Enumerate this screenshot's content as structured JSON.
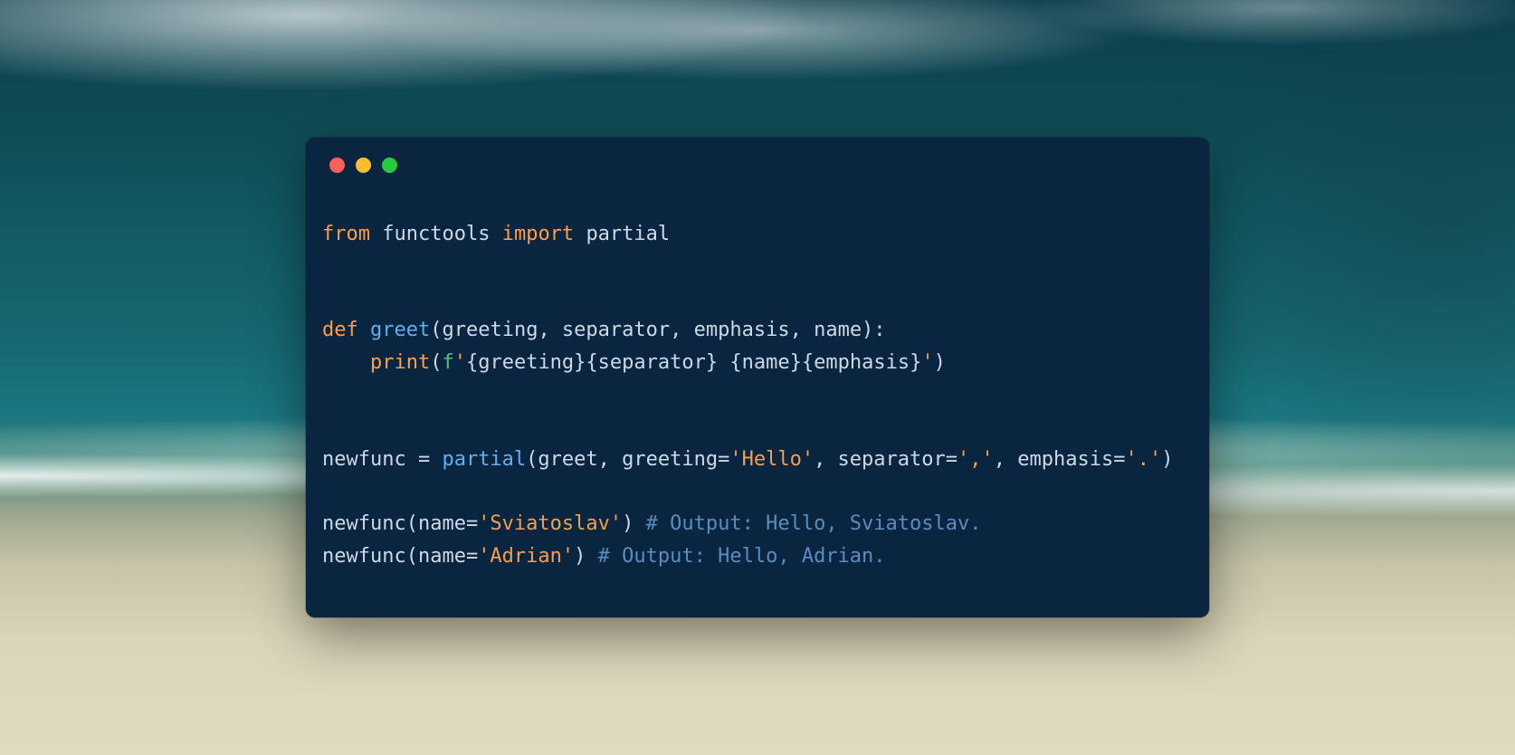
{
  "window": {
    "controls": {
      "red": "#ff5f56",
      "yellow": "#ffbd2e",
      "green": "#27c93f"
    }
  },
  "code": {
    "line1": {
      "kw_from": "from",
      "sp1": " ",
      "module": "functools",
      "sp2": " ",
      "kw_import": "import",
      "sp3": " ",
      "name": "partial"
    },
    "line4": {
      "kw_def": "def",
      "sp1": " ",
      "fname": "greet",
      "sig": "(greeting, separator, emphasis, name):"
    },
    "line5": {
      "indent": "    ",
      "builtin": "print",
      "open": "(",
      "f": "f",
      "q1": "'",
      "e1": "{greeting}",
      "e2": "{separator}",
      "lit": " ",
      "e3": "{name}",
      "e4": "{emphasis}",
      "q2": "'",
      "close": ")"
    },
    "line8": {
      "lhs": "newfunc = ",
      "fn": "partial",
      "args_a": "(greet, greeting=",
      "s1": "'Hello'",
      "args_b": ", separator=",
      "s2": "','",
      "args_c": ", emphasis=",
      "s3": "'.'",
      "close": ")"
    },
    "line10": {
      "call": "newfunc(name=",
      "s": "'Sviatoslav'",
      "close": ") ",
      "comment": "# Output: Hello, Sviatoslav."
    },
    "line11": {
      "call": "newfunc(name=",
      "s": "'Adrian'",
      "close": ") ",
      "comment": "# Output: Hello, Adrian."
    }
  }
}
